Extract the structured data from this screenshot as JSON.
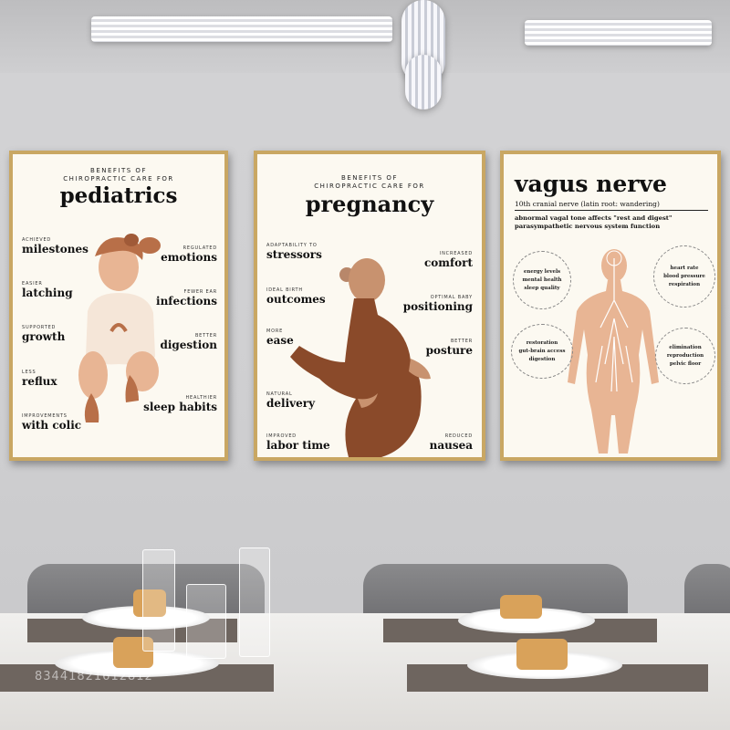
{
  "posters": {
    "pediatrics": {
      "kicker": "BENEFITS OF\nCHIROPRACTIC CARE FOR",
      "title": "pediatrics",
      "left": [
        {
          "small": "ACHIEVED",
          "big": "milestones"
        },
        {
          "small": "EASIER",
          "big": "latching"
        },
        {
          "small": "SUPPORTED",
          "big": "growth"
        },
        {
          "small": "LESS",
          "big": "reflux"
        },
        {
          "small": "IMPROVEMENTS",
          "big": "with colic"
        }
      ],
      "right": [
        {
          "small": "REGULATED",
          "big": "emotions"
        },
        {
          "small": "FEWER EAR",
          "big": "infections"
        },
        {
          "small": "BETTER",
          "big": "digestion"
        },
        {
          "small": "HEALTHIER",
          "big": "sleep habits"
        }
      ]
    },
    "pregnancy": {
      "kicker": "BENEFITS OF\nCHIROPRACTIC CARE FOR",
      "title": "pregnancy",
      "left": [
        {
          "small": "ADAPTABILITY TO",
          "big": "stressors"
        },
        {
          "small": "IDEAL BIRTH",
          "big": "outcomes"
        },
        {
          "small": "MORE",
          "big": "ease"
        },
        {
          "small": "NATURAL",
          "big": "delivery"
        },
        {
          "small": "IMPROVED",
          "big": "labor time"
        }
      ],
      "right": [
        {
          "small": "INCREASED",
          "big": "comfort"
        },
        {
          "small": "OPTIMAL BABY",
          "big": "positioning"
        },
        {
          "small": "BETTER",
          "big": "posture"
        },
        {
          "small": "REDUCED",
          "big": "nausea"
        }
      ]
    },
    "vagus": {
      "title": "vagus nerve",
      "subtitle": "10th cranial nerve (latin root: wandering)",
      "text": "abnormal vagal tone affects \"rest and digest\" parasympathetic nervous system function",
      "bubbles": {
        "energy": [
          "energy levels",
          "mental health",
          "sleep quality"
        ],
        "heart": [
          "heart rate",
          "blood pressure",
          "respiration"
        ],
        "restoration": [
          "restoration",
          "gut-brain access",
          "digestion"
        ],
        "elimination": [
          "elimination",
          "reproduction",
          "pelvic floor"
        ]
      }
    }
  },
  "watermark": "83441821612812",
  "colors": {
    "skin_light": "#e8b594",
    "skin_dark": "#8a4a2a",
    "bow": "#b86f48",
    "frame": "#c9a763"
  }
}
